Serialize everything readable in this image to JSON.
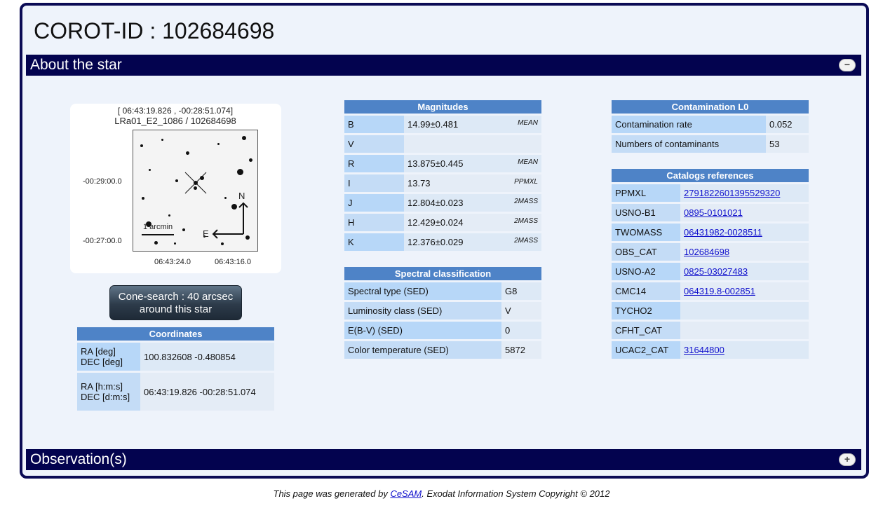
{
  "page": {
    "title": "COROT-ID : 102684698"
  },
  "sections": {
    "about": "About the star",
    "about_toggle": "−",
    "observations": "Observation(s)",
    "observations_toggle": "+"
  },
  "image": {
    "coords": "[ 06:43:19.826 , -00:28:51.074]",
    "name": "LRa01_E2_1086 / 102684698",
    "y_tick_1": "-00:29:00.0",
    "y_tick_2": "-00:27:00.0",
    "x_tick_1": "06:43:24.0",
    "x_tick_2": "06:43:16.0",
    "scale_label": "1 arcmin",
    "north": "N",
    "east": "E"
  },
  "cone_search": "Cone-search : 40 arcsec around this star",
  "coordinates": {
    "header": "Coordinates",
    "rows": [
      {
        "k": "RA [deg] DEC [deg]",
        "v": "100.832608 -0.480854"
      },
      {
        "k": "RA [h:m:s] DEC [d:m:s]",
        "v": "06:43:19.826 -00:28:51.074"
      }
    ]
  },
  "magnitudes": {
    "header": "Magnitudes",
    "rows": [
      {
        "k": "B",
        "v": "14.99±0.481",
        "src": "MEAN"
      },
      {
        "k": "V",
        "v": "",
        "src": ""
      },
      {
        "k": "R",
        "v": "13.875±0.445",
        "src": "MEAN"
      },
      {
        "k": "I",
        "v": "13.73",
        "src": "PPMXL"
      },
      {
        "k": "J",
        "v": "12.804±0.023",
        "src": "2MASS"
      },
      {
        "k": "H",
        "v": "12.429±0.024",
        "src": "2MASS"
      },
      {
        "k": "K",
        "v": "12.376±0.029",
        "src": "2MASS"
      }
    ]
  },
  "spectral": {
    "header": "Spectral classification",
    "rows": [
      {
        "k": "Spectral type (SED)",
        "v": "G8"
      },
      {
        "k": "Luminosity class (SED)",
        "v": "V"
      },
      {
        "k": "E(B-V) (SED)",
        "v": "0"
      },
      {
        "k": "Color temperature (SED)",
        "v": "5872"
      }
    ]
  },
  "contamination": {
    "header": "Contamination L0",
    "rows": [
      {
        "k": "Contamination rate",
        "v": "0.052"
      },
      {
        "k": "Numbers of contaminants",
        "v": "53"
      }
    ]
  },
  "catalogs": {
    "header": "Catalogs references",
    "rows": [
      {
        "k": "PPMXL",
        "v": "2791822601395529320"
      },
      {
        "k": "USNO-B1",
        "v": "0895-0101021"
      },
      {
        "k": "TWOMASS",
        "v": "06431982-0028511"
      },
      {
        "k": "OBS_CAT",
        "v": "102684698"
      },
      {
        "k": "USNO-A2",
        "v": "0825-03027483"
      },
      {
        "k": "CMC14",
        "v": "064319.8-002851"
      },
      {
        "k": "TYCHO2",
        "v": ""
      },
      {
        "k": "CFHT_CAT",
        "v": ""
      },
      {
        "k": "UCAC2_CAT",
        "v": "31644800"
      }
    ]
  },
  "footer": {
    "prefix": "This page was generated by ",
    "link": "CeSAM",
    "suffix": ". Exodat Information System Copyright © 2012"
  }
}
